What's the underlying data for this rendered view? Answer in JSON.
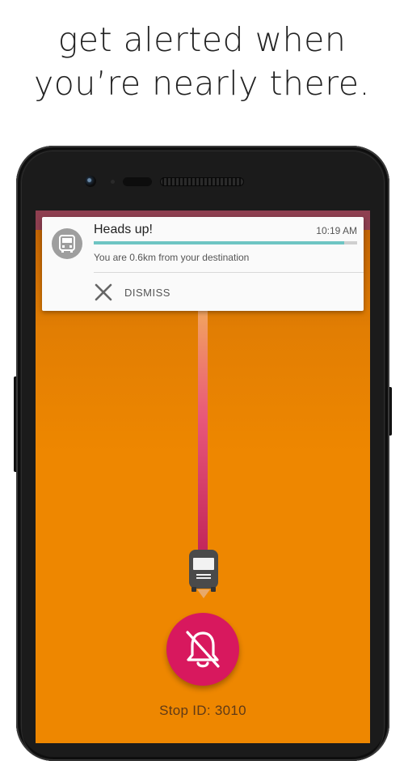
{
  "headline": {
    "line1": "get alerted when",
    "line2": "you’re nearly there."
  },
  "notification": {
    "title": "Heads up!",
    "time": "10:19 AM",
    "progress": 0.95,
    "message": "You are 0.6km from your destination",
    "action_label": "DISMISS",
    "avatar_icon": "bus-icon",
    "action_icon": "close-icon"
  },
  "screen": {
    "stop_label": "Stop ID: 3010",
    "alarm_icon": "alarm-off-icon"
  },
  "colors": {
    "screen_background": "#ee8700",
    "alarm_button": "#d8185e",
    "progress_fill": "#6ec5c3",
    "status_bar": "#8e3f50"
  }
}
